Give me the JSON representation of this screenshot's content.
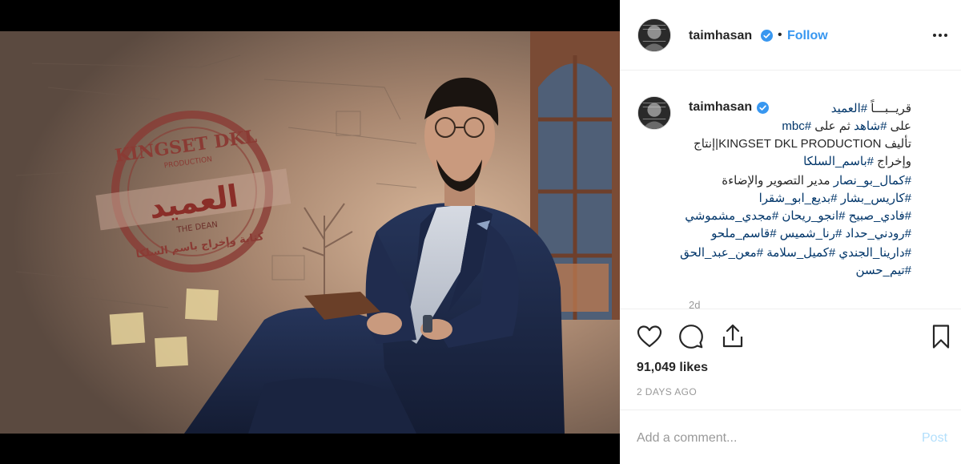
{
  "post": {
    "username": "taimhasan",
    "follow_label": "Follow",
    "separator": "•"
  },
  "caption": {
    "username": "taimhasan",
    "lines": [
      [
        {
          "text": "قريــبـــاً",
          "tag": false
        },
        {
          "text": " ",
          "tag": false
        },
        {
          "text": "#العميد",
          "tag": true
        }
      ],
      [
        {
          "text": "على ",
          "tag": false
        },
        {
          "text": "#شاهد",
          "tag": true
        },
        {
          "text": " ثم على ",
          "tag": false
        },
        {
          "text": "#mbc",
          "tag": true
        }
      ],
      [
        {
          "text": "تأليف KINGSET DKL PRODUCTION|إنتاج",
          "tag": false
        }
      ],
      [
        {
          "text": "وإخراج ",
          "tag": false
        },
        {
          "text": "#باسم_السلكا",
          "tag": true
        }
      ],
      [
        {
          "text": "#كمال_بو_نصار",
          "tag": true
        },
        {
          "text": " مدير التصوير والإضاءة",
          "tag": false
        }
      ],
      [
        {
          "text": "#كاريس_بشار",
          "tag": true
        },
        {
          "text": " ",
          "tag": false
        },
        {
          "text": "#بديع_ابو_شقرا",
          "tag": true
        }
      ],
      [
        {
          "text": "#فادي_صبيح",
          "tag": true
        },
        {
          "text": " ",
          "tag": false
        },
        {
          "text": "#انجو_ريحان",
          "tag": true
        },
        {
          "text": " ",
          "tag": false
        },
        {
          "text": "#مجدي_مشموشي",
          "tag": true
        }
      ],
      [
        {
          "text": "#رودني_حداد",
          "tag": true
        },
        {
          "text": " ",
          "tag": false
        },
        {
          "text": "#رنا_شميس",
          "tag": true
        },
        {
          "text": " ",
          "tag": false
        },
        {
          "text": "#قاسم_ملحو",
          "tag": true
        }
      ],
      [
        {
          "text": "#دارينا_الجندي",
          "tag": true
        },
        {
          "text": " ",
          "tag": false
        },
        {
          "text": "#كميل_سلامة",
          "tag": true
        },
        {
          "text": " ",
          "tag": false
        },
        {
          "text": "#معن_عبد_الحق",
          "tag": true
        }
      ],
      [
        {
          "text": "#تيم_حسن",
          "tag": true
        }
      ]
    ],
    "time_partial": "2d"
  },
  "media": {
    "logo_top": "KINGSET DKL",
    "logo_sub": "PRODUCTION",
    "logo_title": "العميد",
    "logo_en": "THE DEAN",
    "logo_credit": "كتابة وإخراج باسم السلكا"
  },
  "icons": [
    "more-icon",
    "verified-icon",
    "heart-icon",
    "comment-icon",
    "share-icon",
    "bookmark-icon"
  ],
  "colors": {
    "link": "#3897f0",
    "hashtag": "#003569",
    "muted": "#999999",
    "post_disabled": "#b2dffc"
  },
  "stats": {
    "likes": "91,049 likes",
    "age": "2 DAYS AGO"
  },
  "comment": {
    "placeholder": "Add a comment...",
    "post_label": "Post"
  }
}
